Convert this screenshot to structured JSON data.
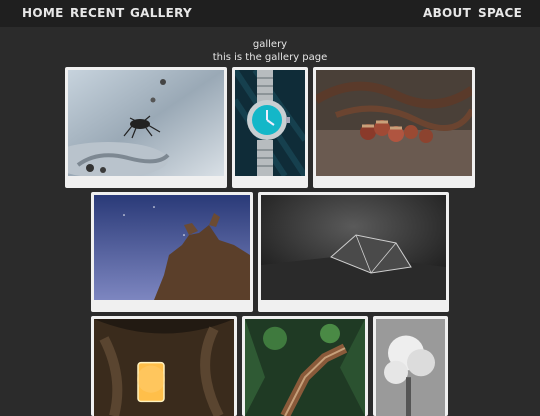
{
  "nav": {
    "left": [
      "HOME",
      "RECENT",
      "GALLERY"
    ],
    "right": [
      "ABOUT",
      "SPACE"
    ]
  },
  "page": {
    "title": "gallery",
    "subtitle": "this is the gallery page"
  },
  "gallery": {
    "photos": [
      {
        "subject": "insect-on-wet-sand"
      },
      {
        "subject": "wristwatch"
      },
      {
        "subject": "acorns-and-chain"
      },
      {
        "subject": "driftwood-under-night-sky"
      },
      {
        "subject": "glass-prism-in-light"
      },
      {
        "subject": "glowing-jar-in-cave"
      },
      {
        "subject": "forest-boardwalk"
      },
      {
        "subject": "white-tree"
      }
    ]
  }
}
